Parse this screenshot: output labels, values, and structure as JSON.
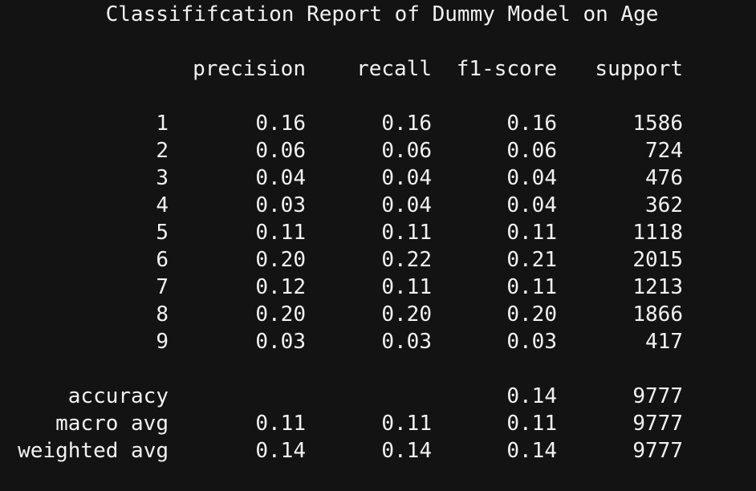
{
  "title": "Classififcation Report of Dummy Model on Age",
  "columns": [
    "precision",
    "recall",
    "f1-score",
    "support"
  ],
  "class_rows": [
    {
      "label": "1",
      "precision": "0.16",
      "recall": "0.16",
      "f1": "0.16",
      "support": "1586"
    },
    {
      "label": "2",
      "precision": "0.06",
      "recall": "0.06",
      "f1": "0.06",
      "support": "724"
    },
    {
      "label": "3",
      "precision": "0.04",
      "recall": "0.04",
      "f1": "0.04",
      "support": "476"
    },
    {
      "label": "4",
      "precision": "0.03",
      "recall": "0.04",
      "f1": "0.04",
      "support": "362"
    },
    {
      "label": "5",
      "precision": "0.11",
      "recall": "0.11",
      "f1": "0.11",
      "support": "1118"
    },
    {
      "label": "6",
      "precision": "0.20",
      "recall": "0.22",
      "f1": "0.21",
      "support": "2015"
    },
    {
      "label": "7",
      "precision": "0.12",
      "recall": "0.11",
      "f1": "0.11",
      "support": "1213"
    },
    {
      "label": "8",
      "precision": "0.20",
      "recall": "0.20",
      "f1": "0.20",
      "support": "1866"
    },
    {
      "label": "9",
      "precision": "0.03",
      "recall": "0.03",
      "f1": "0.03",
      "support": "417"
    }
  ],
  "summary_rows": [
    {
      "label": "accuracy",
      "precision": "",
      "recall": "",
      "f1": "0.14",
      "support": "9777"
    },
    {
      "label": "macro avg",
      "precision": "0.11",
      "recall": "0.11",
      "f1": "0.11",
      "support": "9777"
    },
    {
      "label": "weighted avg",
      "precision": "0.14",
      "recall": "0.14",
      "f1": "0.14",
      "support": "9777"
    }
  ],
  "colors": {
    "background": "#131313",
    "text": "#f2f2f2"
  }
}
